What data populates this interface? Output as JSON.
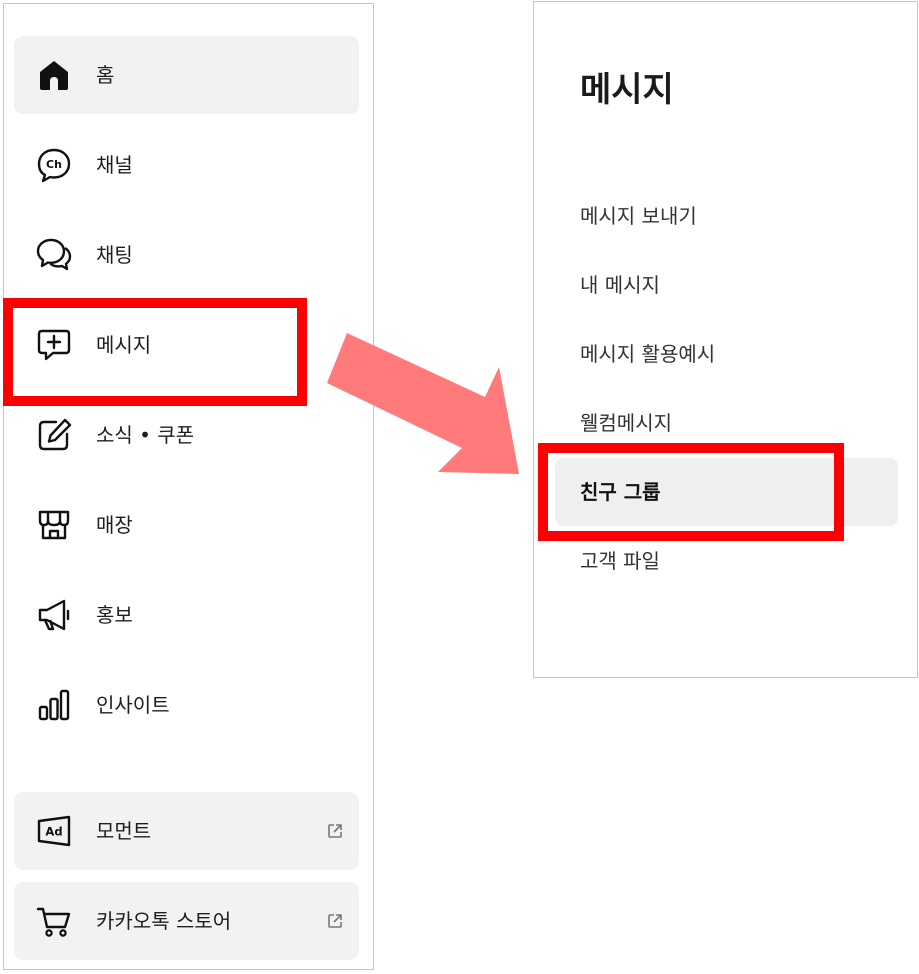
{
  "sidebar": {
    "items": [
      {
        "label": "홈",
        "icon": "home-icon"
      },
      {
        "label": "채널",
        "icon": "channel-icon"
      },
      {
        "label": "채팅",
        "icon": "chat-icon"
      },
      {
        "label": "메시지",
        "icon": "message-add-icon"
      },
      {
        "label": "소식 • 쿠폰",
        "icon": "edit-icon"
      },
      {
        "label": "매장",
        "icon": "store-icon"
      },
      {
        "label": "홍보",
        "icon": "megaphone-icon"
      },
      {
        "label": "인사이트",
        "icon": "bar-chart-icon"
      },
      {
        "label": "모먼트",
        "icon": "ad-icon"
      },
      {
        "label": "카카오톡 스토어",
        "icon": "cart-icon"
      }
    ]
  },
  "submenu": {
    "title": "메시지",
    "items": [
      {
        "label": "메시지 보내기"
      },
      {
        "label": "내 메시지"
      },
      {
        "label": "메시지 활용예시"
      },
      {
        "label": "웰컴메시지"
      },
      {
        "label": "친구 그룹"
      },
      {
        "label": "고객 파일"
      }
    ]
  },
  "colors": {
    "highlight": "#ff0000",
    "arrow": "#ff7a7a",
    "shaded": "#f2f2f2",
    "border": "#c4c4c4"
  }
}
